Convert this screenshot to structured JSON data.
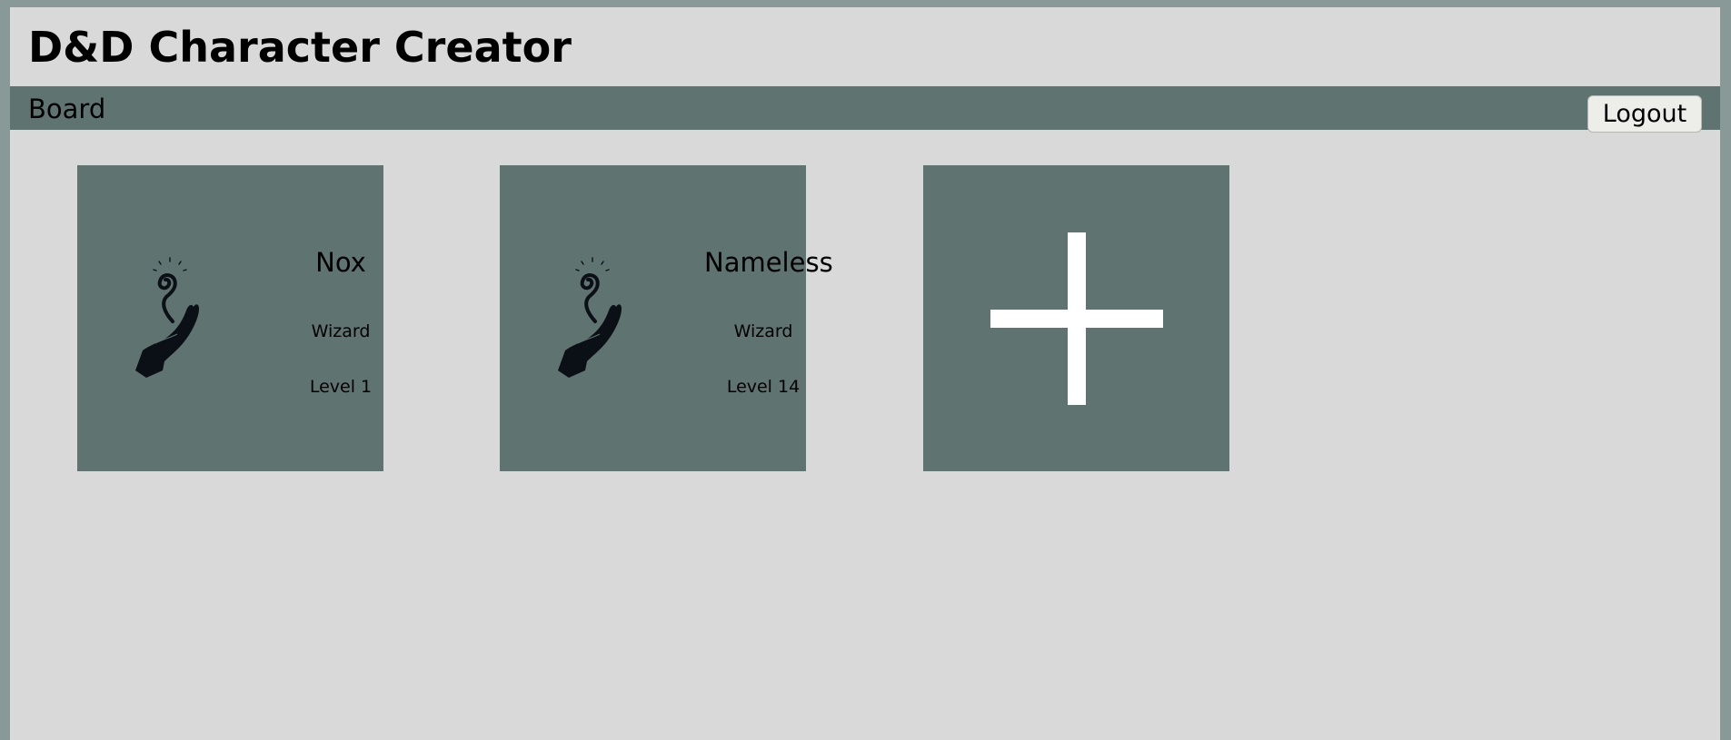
{
  "header": {
    "title": "D&D Character Creator"
  },
  "nav": {
    "board_label": "Board",
    "logout_label": "Logout"
  },
  "characters": [
    {
      "name": "Nox",
      "class": "Wizard",
      "level": "Level 1",
      "icon": "wizard-hand-icon"
    },
    {
      "name": "Nameless",
      "class": "Wizard",
      "level": "Level 14",
      "icon": "wizard-hand-icon"
    }
  ],
  "add_card": {
    "icon": "plus-icon"
  },
  "colors": {
    "background": "#d9d9d9",
    "frame": "#889998",
    "accent": "#5f7471",
    "button": "#ededea"
  }
}
